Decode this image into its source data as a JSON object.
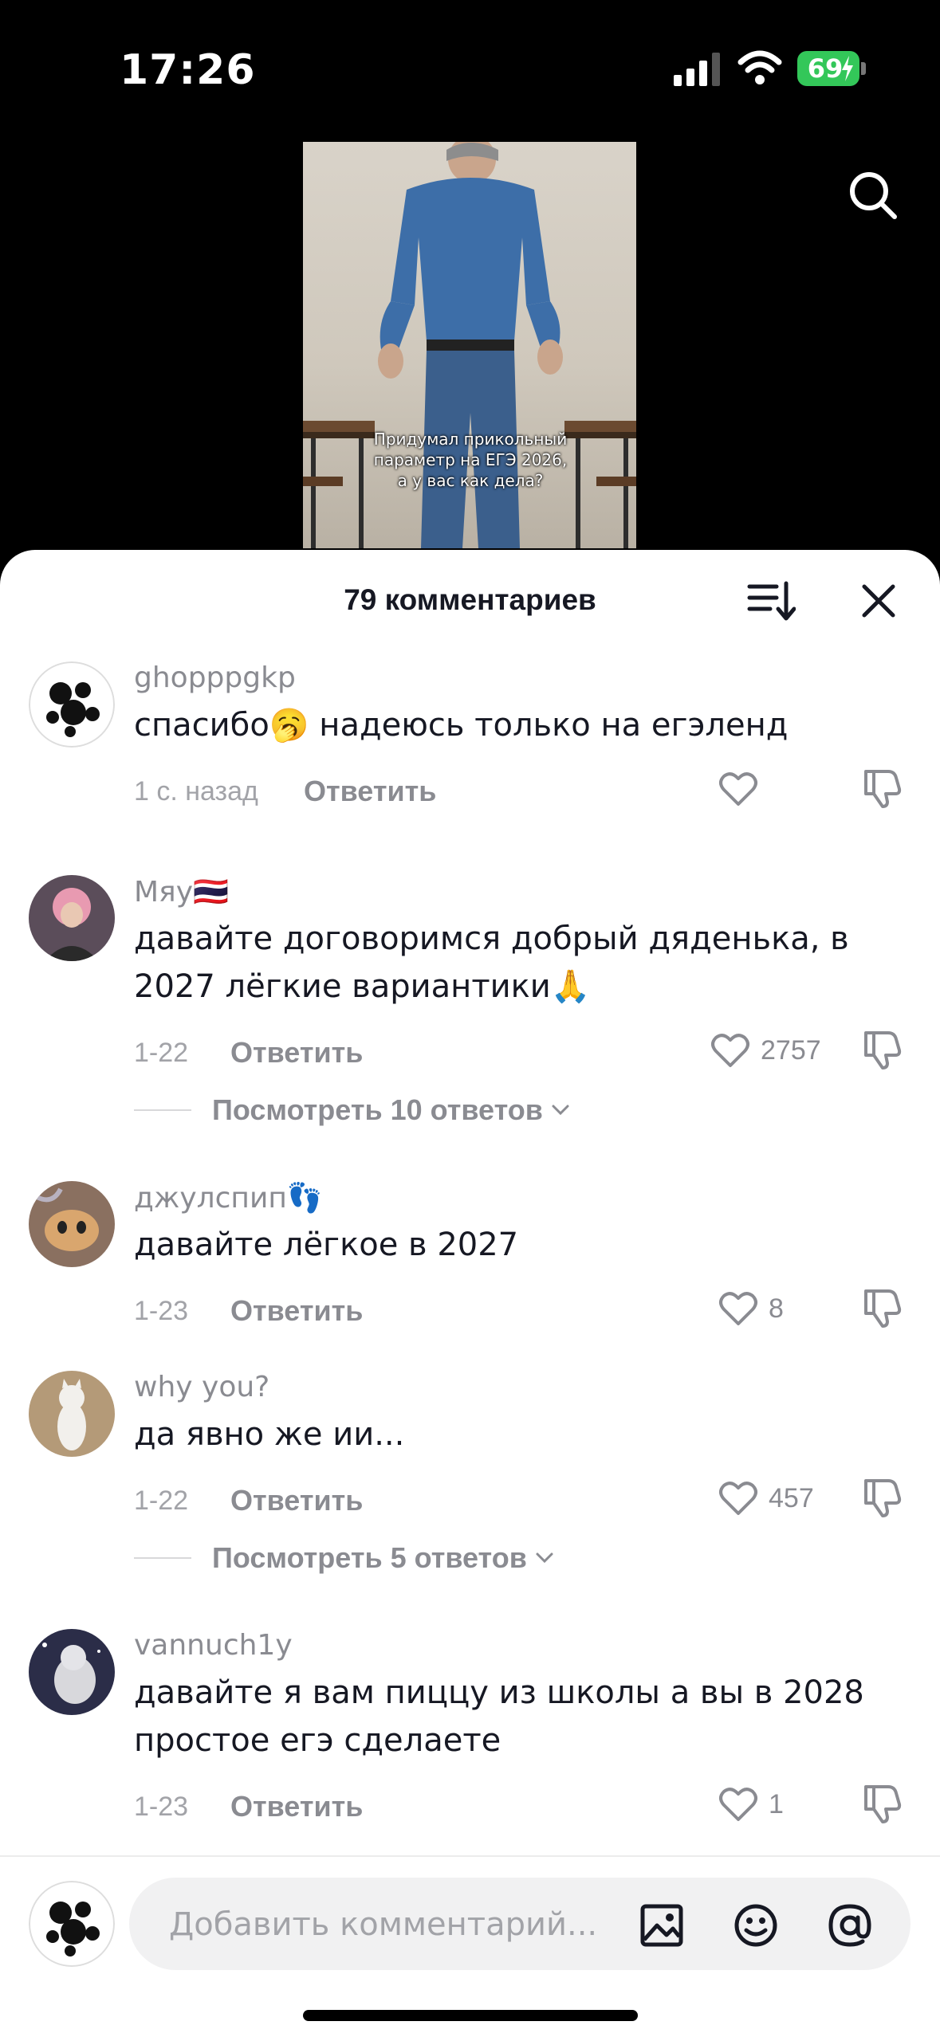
{
  "status_bar": {
    "time": "17:26",
    "battery": "69"
  },
  "video": {
    "caption": "Придумал прикольный параметр на ЕГЭ 2026, а у вас как дела?"
  },
  "sheet": {
    "title": "79 комментариев"
  },
  "comments": [
    {
      "username": "ghopppgkp",
      "text": "спасибо🥱 надеюсь только на егэленд",
      "time": "1 с. назад",
      "reply_label": "Ответить",
      "likes": ""
    },
    {
      "username": "Мяу🇹🇭",
      "text": "давайте договоримся добрый дяденька, в 2027 лёгкие вариантики🙏",
      "time": "1-22",
      "reply_label": "Ответить",
      "likes": "2757",
      "view_replies": "Посмотреть 10 ответов"
    },
    {
      "username": "джулспип👣",
      "text": "давайте лёгкое в 2027",
      "time": "1-23",
      "reply_label": "Ответить",
      "likes": "8"
    },
    {
      "username": "why you?",
      "text": "да явно же ии...",
      "time": "1-22",
      "reply_label": "Ответить",
      "likes": "457",
      "view_replies": "Посмотреть 5 ответов"
    },
    {
      "username": "vannuch1y",
      "text": "давайте я вам пиццу из школы а вы в 2028 простое егэ сделаете",
      "time": "1-23",
      "reply_label": "Ответить",
      "likes": "1"
    }
  ],
  "input": {
    "placeholder": "Добавить комментарий..."
  },
  "icons": [
    "signal-icon",
    "wifi-icon",
    "battery-icon",
    "search-icon",
    "sort-icon",
    "close-icon",
    "heart-icon",
    "dislike-icon",
    "chevron-down-icon",
    "image-icon",
    "emoji-icon",
    "mention-icon"
  ],
  "colors": {
    "accent_battery": "#33c759",
    "text_primary": "#161823",
    "text_secondary": "#8a8b91",
    "input_bg": "#f1f1f2"
  }
}
